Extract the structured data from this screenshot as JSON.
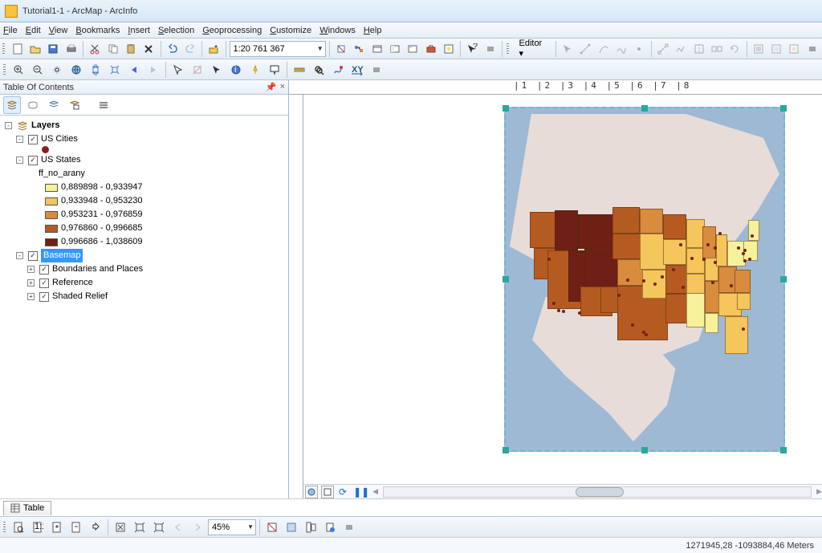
{
  "window_title": "Tutorial1-1 - ArcMap - ArcInfo",
  "menu": {
    "file": "File",
    "edit": "Edit",
    "view": "View",
    "bookmarks": "Bookmarks",
    "insert": "Insert",
    "selection": "Selection",
    "geoprocessing": "Geoprocessing",
    "customize": "Customize",
    "windows": "Windows",
    "help": "Help"
  },
  "scale": "1:20 761 367",
  "editor_label": "Editor ▾",
  "toc": {
    "title": "Table Of Contents",
    "pin_glyph": "📌",
    "close_glyph": "×"
  },
  "tree": {
    "layers": "Layers",
    "us_cities": "US Cities",
    "us_states": "US States",
    "field": "ff_no_arany",
    "r1": "0,889898 - 0,933947",
    "r2": "0,933948 - 0,953230",
    "r3": "0,953231 - 0,976859",
    "r4": "0,976860 - 0,996685",
    "r5": "0,996686 - 1,038609",
    "basemap": "Basemap",
    "bp": "Boundaries and Places",
    "ref": "Reference",
    "sr": "Shaded Relief"
  },
  "colors": {
    "r1": "#f8f19c",
    "r2": "#f4c65c",
    "r3": "#d98b3e",
    "r4": "#b55b22",
    "r5": "#6e1f16"
  },
  "zoom": "45%",
  "table_tab": "Table",
  "ruler_h": "|1    |2    |3    |4    |5    |6    |7    |8",
  "coords": "1271945,28 -1093884,46 Meters"
}
